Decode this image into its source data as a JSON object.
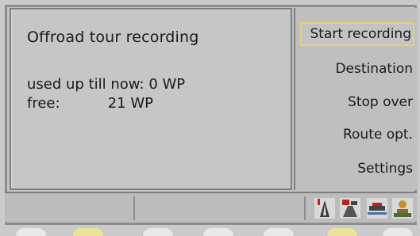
{
  "main": {
    "title": "Offroad tour recording",
    "used_label": "used up till now:",
    "used_value": "0 WP",
    "free_label": "free:",
    "free_value": "21 WP"
  },
  "menu": {
    "items": [
      {
        "label": "Start recording",
        "selected": true
      },
      {
        "label": "Destination"
      },
      {
        "label": "Stop over"
      },
      {
        "label": "Route opt."
      },
      {
        "label": "Settings"
      }
    ]
  },
  "status_bar": {
    "icons": [
      "road-warning-icon",
      "traffic-sign-icon",
      "ferry-icon",
      "person-icon"
    ]
  },
  "colors": {
    "selection_border": "#e5d07a",
    "background": "#c6c6c6",
    "softkey_active": "#ebe39a"
  }
}
